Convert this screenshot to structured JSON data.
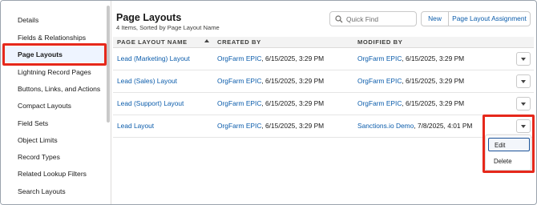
{
  "sidebar": {
    "items": [
      {
        "label": "Details",
        "active": false
      },
      {
        "label": "Fields & Relationships",
        "active": false
      },
      {
        "label": "Page Layouts",
        "active": true
      },
      {
        "label": "Lightning Record Pages",
        "active": false
      },
      {
        "label": "Buttons, Links, and Actions",
        "active": false
      },
      {
        "label": "Compact Layouts",
        "active": false
      },
      {
        "label": "Field Sets",
        "active": false
      },
      {
        "label": "Object Limits",
        "active": false
      },
      {
        "label": "Record Types",
        "active": false
      },
      {
        "label": "Related Lookup Filters",
        "active": false
      },
      {
        "label": "Search Layouts",
        "active": false
      }
    ]
  },
  "header": {
    "title": "Page Layouts",
    "subtitle": "4 Items, Sorted by Page Layout Name"
  },
  "search": {
    "placeholder": "Quick Find",
    "value": "",
    "icon": "search-icon"
  },
  "actions": {
    "new_label": "New",
    "assignment_label": "Page Layout Assignment"
  },
  "table": {
    "columns": [
      "PAGE LAYOUT NAME",
      "CREATED BY",
      "MODIFIED BY"
    ],
    "sort_column": "PAGE LAYOUT NAME",
    "sort_direction": "ascending",
    "rows": [
      {
        "name": "Lead (Marketing) Layout",
        "created_by": "OrgFarm EPIC",
        "created_at": ", 6/15/2025, 3:29 PM",
        "modified_by": "OrgFarm EPIC",
        "modified_at": ", 6/15/2025, 3:29 PM"
      },
      {
        "name": "Lead (Sales) Layout",
        "created_by": "OrgFarm EPIC",
        "created_at": ", 6/15/2025, 3:29 PM",
        "modified_by": "OrgFarm EPIC",
        "modified_at": ", 6/15/2025, 3:29 PM"
      },
      {
        "name": "Lead (Support) Layout",
        "created_by": "OrgFarm EPIC",
        "created_at": ", 6/15/2025, 3:29 PM",
        "modified_by": "OrgFarm EPIC",
        "modified_at": ", 6/15/2025, 3:29 PM"
      },
      {
        "name": "Lead Layout",
        "created_by": "OrgFarm EPIC",
        "created_at": ", 6/15/2025, 3:29 PM",
        "modified_by": "Sanctions.io Demo",
        "modified_at": ", 7/8/2025, 4:01 PM"
      }
    ]
  },
  "row_menu": {
    "items": [
      "Edit",
      "Delete"
    ],
    "focused": "Edit"
  },
  "colors": {
    "link": "#0b5cab",
    "highlight": "#e6281b",
    "active_bg": "#eef4ff"
  }
}
